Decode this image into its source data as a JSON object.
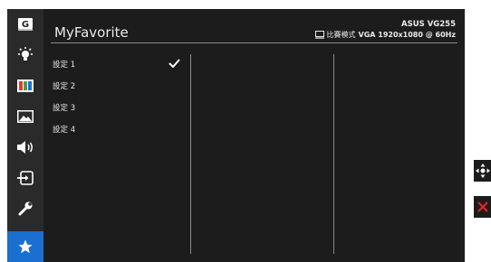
{
  "page": {
    "title": "MyFavorite"
  },
  "monitor": {
    "model": "ASUS VG255",
    "mode_label": "比賽模式",
    "signal": "VGA 1920x1080 @ 60Hz"
  },
  "sidebar": {
    "items": [
      {
        "icon": "gameplus-icon",
        "glyph": "G"
      },
      {
        "icon": "brightness-icon"
      },
      {
        "icon": "color-icon"
      },
      {
        "icon": "image-icon"
      },
      {
        "icon": "sound-icon"
      },
      {
        "icon": "input-select-icon"
      },
      {
        "icon": "system-setup-icon"
      },
      {
        "icon": "star-icon",
        "active": true
      }
    ]
  },
  "menu": {
    "items": [
      {
        "label": "設定 1",
        "selected": true
      },
      {
        "label": "設定 2"
      },
      {
        "label": "設定 3"
      },
      {
        "label": "設定 4"
      }
    ]
  },
  "controls": [
    {
      "icon": "navigation-icon"
    },
    {
      "icon": "close-icon"
    }
  ],
  "colors": {
    "accent": "#1a6fd1",
    "close": "#e02424"
  }
}
